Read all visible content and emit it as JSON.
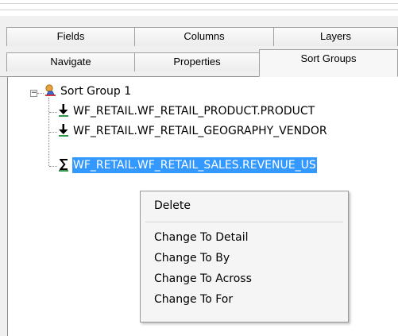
{
  "tabs_row1": [
    {
      "label": "Fields"
    },
    {
      "label": "Columns"
    },
    {
      "label": "Layers"
    }
  ],
  "tabs_row2": [
    {
      "label": "Navigate"
    },
    {
      "label": "Properties"
    },
    {
      "label": "Sort Groups",
      "active": true
    }
  ],
  "tree": {
    "root": {
      "label": "Sort Group 1",
      "icon": "sort-group-icon",
      "expanded": true
    },
    "children": [
      {
        "label": "WF_RETAIL.WF_RETAIL_PRODUCT.PRODUCT",
        "icon": "sort-by-arrow-icon"
      },
      {
        "label": "WF_RETAIL.WF_RETAIL_GEOGRAPHY_VENDOR",
        "icon": "sort-by-arrow-icon"
      },
      {
        "label": "WF_RETAIL.WF_RETAIL_SALES.REVENUE_US",
        "icon": "sum-sigma-icon",
        "selected": true
      }
    ]
  },
  "context_menu": {
    "items": [
      {
        "label": "Delete"
      },
      {
        "label": "Change To Detail"
      },
      {
        "label": "Change To By"
      },
      {
        "label": "Change To Across"
      },
      {
        "label": "Change To For"
      }
    ]
  },
  "colors": {
    "selection": "#3399ff",
    "tab_border": "#a0a0a0",
    "panel_bg": "#f0f0f0"
  }
}
